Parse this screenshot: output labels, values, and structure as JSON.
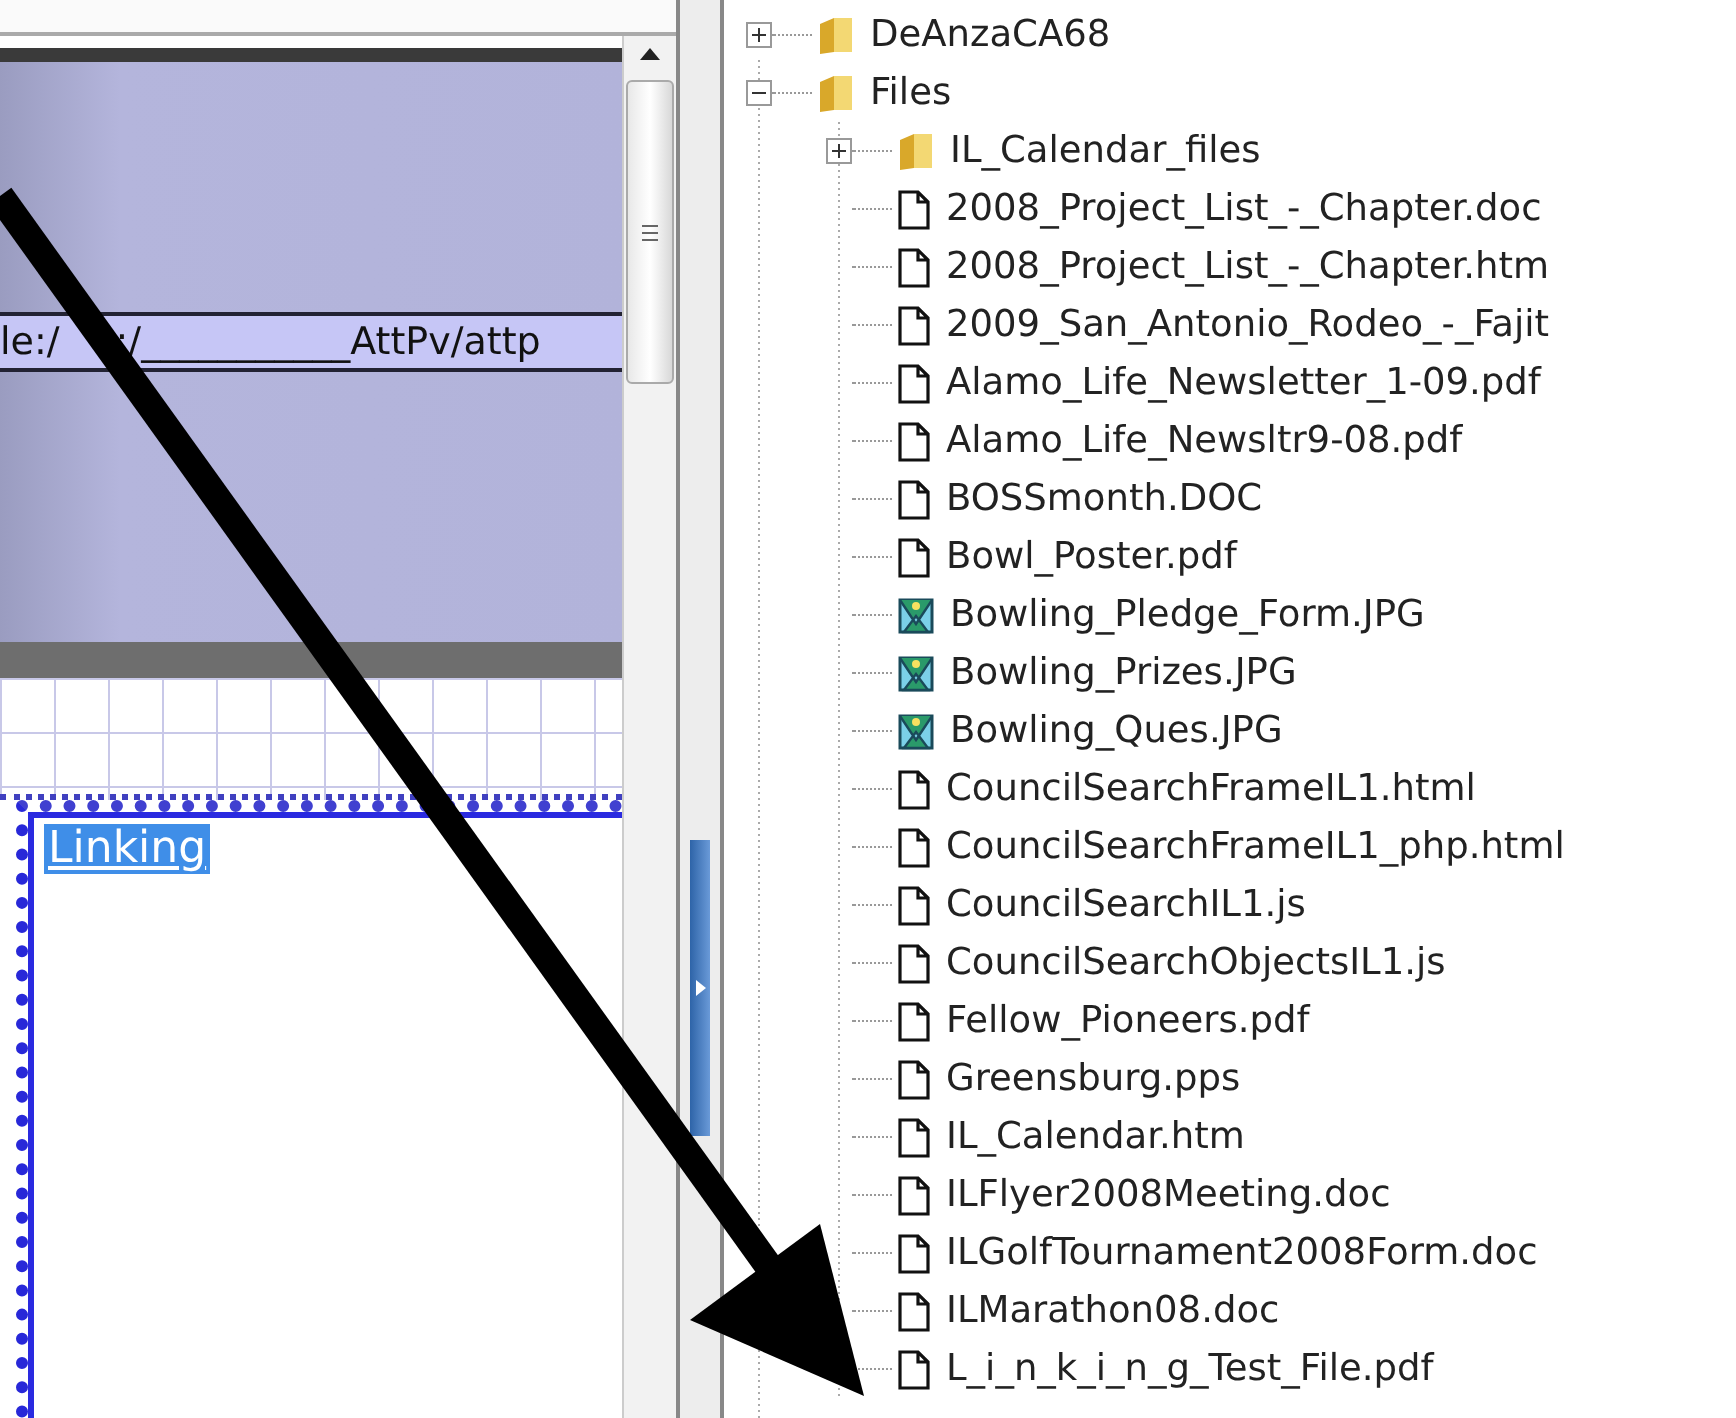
{
  "editor": {
    "address_parts": [
      "le:/",
      ":/___________AttPv/attp"
    ],
    "selected_text": "Linking"
  },
  "tree": [
    {
      "kind": "folder",
      "label": "DeAnzaCA68",
      "expanded": false
    },
    {
      "kind": "folder",
      "label": "Files",
      "expanded": true,
      "children": [
        {
          "kind": "folder",
          "label": "IL_Calendar_files",
          "expanded": false
        },
        {
          "kind": "file",
          "label": "2008_Project_List_-_Chapter.doc"
        },
        {
          "kind": "file",
          "label": "2008_Project_List_-_Chapter.htm"
        },
        {
          "kind": "file",
          "label": "2009_San_Antonio_Rodeo_-_Fajit"
        },
        {
          "kind": "file",
          "label": "Alamo_Life_Newsletter_1-09.pdf"
        },
        {
          "kind": "file",
          "label": "Alamo_Life_Newsltr9-08.pdf"
        },
        {
          "kind": "file",
          "label": "BOSSmonth.DOC"
        },
        {
          "kind": "file",
          "label": "Bowl_Poster.pdf"
        },
        {
          "kind": "image",
          "label": "Bowling_Pledge_Form.JPG"
        },
        {
          "kind": "image",
          "label": "Bowling_Prizes.JPG"
        },
        {
          "kind": "image",
          "label": "Bowling_Ques.JPG"
        },
        {
          "kind": "file",
          "label": "CouncilSearchFrameIL1.html"
        },
        {
          "kind": "file",
          "label": "CouncilSearchFrameIL1_php.html"
        },
        {
          "kind": "file",
          "label": "CouncilSearchIL1.js"
        },
        {
          "kind": "file",
          "label": "CouncilSearchObjectsIL1.js"
        },
        {
          "kind": "file",
          "label": "Fellow_Pioneers.pdf"
        },
        {
          "kind": "file",
          "label": "Greensburg.pps"
        },
        {
          "kind": "file",
          "label": "IL_Calendar.htm"
        },
        {
          "kind": "file",
          "label": "ILFlyer2008Meeting.doc"
        },
        {
          "kind": "file",
          "label": "ILGolfTournament2008Form.doc"
        },
        {
          "kind": "file",
          "label": "ILMarathon08.doc"
        },
        {
          "kind": "file",
          "label": "L_i_n_k_i_n_g_Test_File.pdf"
        }
      ]
    }
  ]
}
